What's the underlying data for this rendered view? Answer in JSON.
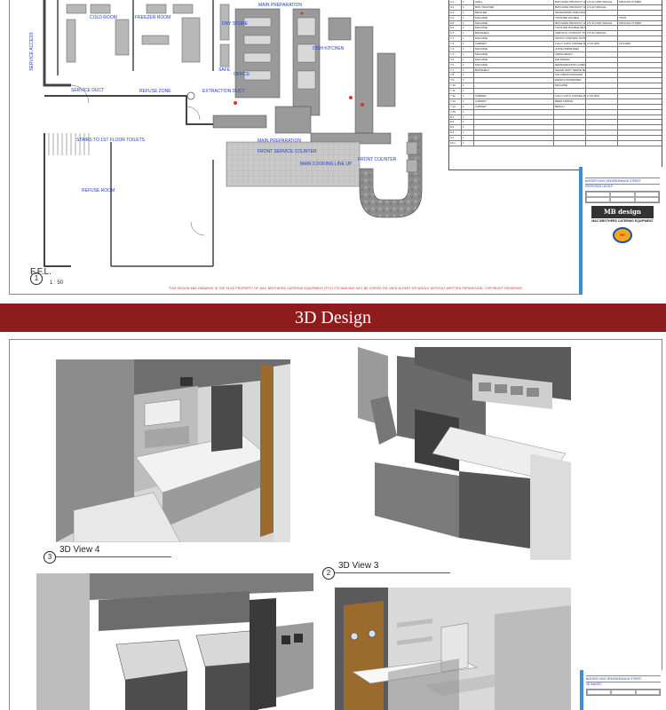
{
  "plan": {
    "rooms": {
      "cold_room": "COLD ROOM",
      "freezer_room": "FREEZER ROOM",
      "dry_store": "DRY STORE",
      "main_preparation": "MAIN PREPARATION",
      "dish_kitchen": "DISH KITCHEN",
      "service_access": "SERVICE ACCESS",
      "service_duct": "SERVICE DUCT",
      "refuse_zone": "REFUSE ZONE",
      "extraction_duct": "EXTRACTION DUCT",
      "safe": "SAFE",
      "office": "OFFICE",
      "stairs": "STAIRS TO 1ST FLOOR TOILETS",
      "refuse_room": "REFUSE ROOM",
      "front_service_counter": "FRONT SERVICE COUNTER",
      "main_preparation_2": "MAIN PREPARATION",
      "main_cooking_line_up": "MAIN COOKING LINE UP",
      "front_counter": "FRONT COUNTER"
    },
    "ffl_title": "F.F.L.",
    "ffl_number": "1",
    "ffl_scale": "1 : 50",
    "copyright_note": "THIS DESIGN AND DRAWING IS THE SOLE PROPERTY OF MAC BROTHERS CATERING EQUIPMENT (PTY) LTD AND MAY NOT BE COPIED OR USED IN PART OR WHOLE WITHOUT WRITTEN PERMISSION. COPYRIGHT RESERVED"
  },
  "schedule": {
    "rows": [
      [
        "6.1",
        "1",
        "GRILL",
        "BATCHING PRODUCT HOLDING UNITS",
        "1/3 GN 20W SINGLE",
        "MANUFACTURED"
      ],
      [
        "6.2",
        "1",
        "BUN TOASTER",
        "BATCHING PRODUCT HOLDING UNITS",
        "1/3 GN SINGLE",
        ""
      ],
      [
        "6.3",
        "1",
        "BROILER",
        "MICROWAVE OVEN MANUAL",
        "",
        ""
      ],
      [
        "6.4",
        "1",
        "MACHINE",
        "TOASTER DOUBLE",
        "",
        "TOAS"
      ],
      [
        "6.5",
        "1",
        "MACHINE",
        "BATCHING PRODUCT HOLDING UNITS",
        "1/3 GN 20W SINGLE",
        "MANUFACTURED"
      ],
      [
        "6.6",
        "1",
        "MACHINE",
        "TOASTER DOUBLE DETENTION SHELF",
        "",
        ""
      ],
      [
        "6.7",
        "1",
        "BUNSHELF",
        "VERTICAL CONTACT TOASTER",
        "1/3 GN SINGLE",
        ""
      ],
      [
        "7.1",
        "1",
        "MACHINE",
        "SHOOT CONTROL STATION",
        "",
        ""
      ],
      [
        "7.2",
        "1",
        "CABINET",
        "FULLY AUTO COFFEE MACHINE",
        "2 GN 20W",
        "KITCHEN"
      ],
      [
        "7.3",
        "1",
        "MACHINE",
        "JUICE DISPENSER",
        "",
        ""
      ],
      [
        "7.4",
        "1",
        "MACHINE",
        "CREW READY",
        "",
        ""
      ],
      [
        "7.5",
        "1",
        "MACHINE",
        "ICE MAKER",
        "",
        ""
      ],
      [
        "7.6",
        "1",
        "MACHINE",
        "REFRIGERATION CABINET",
        "",
        ""
      ],
      [
        "7.7",
        "1",
        "BUNSHELF",
        "SHAKE SOFT SERVE MACHINE",
        "",
        ""
      ],
      [
        "7.8",
        "1",
        "",
        "ICE CREAM MACHINE",
        "",
        ""
      ],
      [
        "7.9",
        "1",
        "",
        "DRINKS DISPENSER",
        "",
        ""
      ],
      [
        "7.10",
        "1",
        "",
        "MACHINE",
        "",
        ""
      ],
      [
        "7.11",
        "1",
        "",
        "",
        "",
        ""
      ],
      [
        "7.12",
        "1",
        "CABINET",
        "FULLY AUTO COFFEE MACHINE",
        "2 GN 20W",
        ""
      ],
      [
        "7.13",
        "1",
        "CABINET",
        "BEER FRIDGE",
        "",
        ""
      ],
      [
        "7.14",
        "1",
        "CABINET",
        "BENCH",
        "",
        ""
      ],
      [
        "7.15",
        "1",
        "",
        "",
        "",
        ""
      ],
      [
        "8.1",
        "1",
        "",
        "",
        "",
        ""
      ],
      [
        "8.2",
        "1",
        "",
        "",
        "",
        ""
      ],
      [
        "8.3",
        "1",
        "",
        "",
        "",
        ""
      ],
      [
        "8.4",
        "1",
        "",
        "",
        "",
        ""
      ],
      [
        "9.1",
        "1",
        "",
        "",
        "",
        ""
      ],
      [
        "10.1",
        "1",
        "",
        "",
        "",
        ""
      ]
    ]
  },
  "title_block": {
    "project": "BURGER KING HEIDENDEMAGH STREET",
    "drawing": "PROPOSED LAYOUT",
    "company_logo": "MB design",
    "company": "MAC BROTHERS CATERING EQUIPMENT",
    "client_logo": "BURGER KING"
  },
  "banner": {
    "title": "3D Design"
  },
  "views": {
    "view4_label": "3D View 4",
    "view4_number": "3",
    "view3_label": "3D View 3",
    "view3_number": "2"
  },
  "title_block_2": {
    "project": "BURGER KING HEIDENDEMAGH STREET",
    "drawing": "3D IMAGES"
  }
}
